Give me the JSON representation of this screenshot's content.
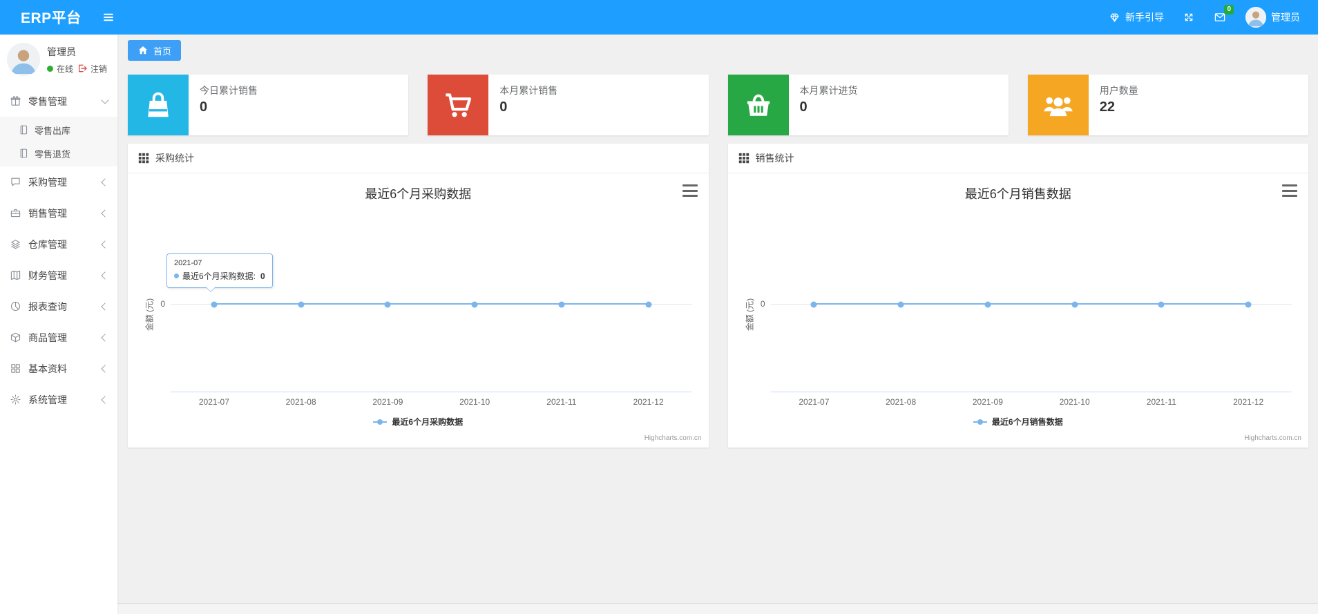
{
  "theme": {
    "navbar": "#1e9fff",
    "tab": "#3d9ff5",
    "badge": "#23ac38",
    "online": "#2fae33",
    "logout": "#d9534f"
  },
  "navbar": {
    "brand": "ERP平台",
    "guide_label": "新手引导",
    "mail_badge": "0",
    "user_name": "管理员"
  },
  "sidebar": {
    "user": {
      "name": "管理员",
      "status": "在线",
      "logout": "注销"
    },
    "items": [
      {
        "label": "零售管理",
        "icon": "gift-icon",
        "expanded": true,
        "children": [
          {
            "label": "零售出库",
            "icon": "journal-icon"
          },
          {
            "label": "零售退货",
            "icon": "journal-icon"
          }
        ]
      },
      {
        "label": "采购管理",
        "icon": "chat-square-icon"
      },
      {
        "label": "销售管理",
        "icon": "briefcase-icon"
      },
      {
        "label": "仓库管理",
        "icon": "layers-icon"
      },
      {
        "label": "财务管理",
        "icon": "map-icon"
      },
      {
        "label": "报表查询",
        "icon": "pie-chart-icon"
      },
      {
        "label": "商品管理",
        "icon": "box-icon"
      },
      {
        "label": "基本资料",
        "icon": "grid-icon"
      },
      {
        "label": "系统管理",
        "icon": "gear-icon"
      }
    ]
  },
  "tabs": [
    {
      "label": "首页",
      "icon": "home-icon",
      "active": true
    }
  ],
  "stat_cards": [
    {
      "label": "今日累计销售",
      "value": "0",
      "color": "#23b7e5",
      "icon": "shopping-bag-icon"
    },
    {
      "label": "本月累计销售",
      "value": "0",
      "color": "#dd4b39",
      "icon": "shopping-cart-icon"
    },
    {
      "label": "本月累计进货",
      "value": "0",
      "color": "#28a745",
      "icon": "shopping-basket-icon"
    },
    {
      "label": "用户数量",
      "value": "22",
      "color": "#f5a623",
      "icon": "users-icon"
    }
  ],
  "panels": [
    {
      "title": "采购统计",
      "icon": "th-icon"
    },
    {
      "title": "销售统计",
      "icon": "th-icon"
    }
  ],
  "chart_data": [
    {
      "type": "line",
      "title": "最近6个月采购数据",
      "categories": [
        "2021-07",
        "2021-08",
        "2021-09",
        "2021-10",
        "2021-11",
        "2021-12"
      ],
      "series": [
        {
          "name": "最近6个月采购数据",
          "values": [
            0,
            0,
            0,
            0,
            0,
            0
          ],
          "color": "#7cb5ec"
        }
      ],
      "xlabel": "",
      "ylabel": "金额 (元)",
      "yticks": [
        "0"
      ],
      "ylim": [
        0,
        0
      ],
      "grid": true,
      "legend_position": "bottom",
      "credits": "Highcharts.com.cn",
      "tooltip": {
        "visible": true,
        "category": "2021-07",
        "series": "最近6个月采购数据",
        "value": "0"
      }
    },
    {
      "type": "line",
      "title": "最近6个月销售数据",
      "categories": [
        "2021-07",
        "2021-08",
        "2021-09",
        "2021-10",
        "2021-11",
        "2021-12"
      ],
      "series": [
        {
          "name": "最近6个月销售数据",
          "values": [
            0,
            0,
            0,
            0,
            0,
            0
          ],
          "color": "#7cb5ec"
        }
      ],
      "xlabel": "",
      "ylabel": "金额 (元)",
      "yticks": [
        "0"
      ],
      "ylim": [
        0,
        0
      ],
      "grid": true,
      "legend_position": "bottom",
      "credits": "Highcharts.com.cn",
      "tooltip": {
        "visible": false
      }
    }
  ]
}
